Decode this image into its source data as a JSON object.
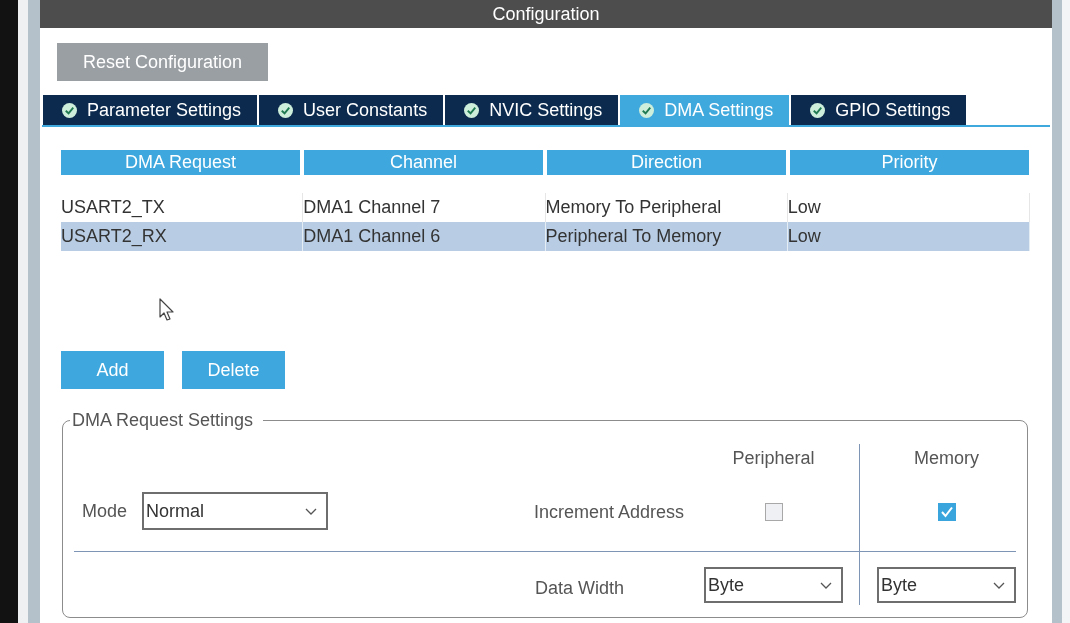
{
  "panel": {
    "title": "Configuration"
  },
  "reset_button": {
    "label": "Reset Configuration"
  },
  "tabs": [
    {
      "label": "Parameter Settings",
      "selected": false
    },
    {
      "label": "User Constants",
      "selected": false
    },
    {
      "label": "NVIC Settings",
      "selected": false
    },
    {
      "label": "DMA Settings",
      "selected": true
    },
    {
      "label": "GPIO Settings",
      "selected": false
    }
  ],
  "table": {
    "columns": [
      "DMA Request",
      "Channel",
      "Direction",
      "Priority"
    ],
    "rows": [
      {
        "cells": [
          "USART2_TX",
          "DMA1 Channel 7",
          "Memory To Peripheral",
          "Low"
        ],
        "selected": false
      },
      {
        "cells": [
          "USART2_RX",
          "DMA1 Channel 6",
          "Peripheral To Memory",
          "Low"
        ],
        "selected": true
      }
    ]
  },
  "buttons": [
    "Add",
    "Delete"
  ],
  "request_settings": {
    "title": "DMA Request Settings",
    "columns": [
      "Peripheral",
      "Memory"
    ],
    "mode": {
      "label": "Mode",
      "value": "Normal"
    },
    "increment_address": {
      "label": "Increment Address",
      "peripheral_checked": false,
      "memory_checked": true
    },
    "data_width": {
      "label": "Data Width",
      "peripheral": "Byte",
      "memory": "Byte"
    }
  }
}
